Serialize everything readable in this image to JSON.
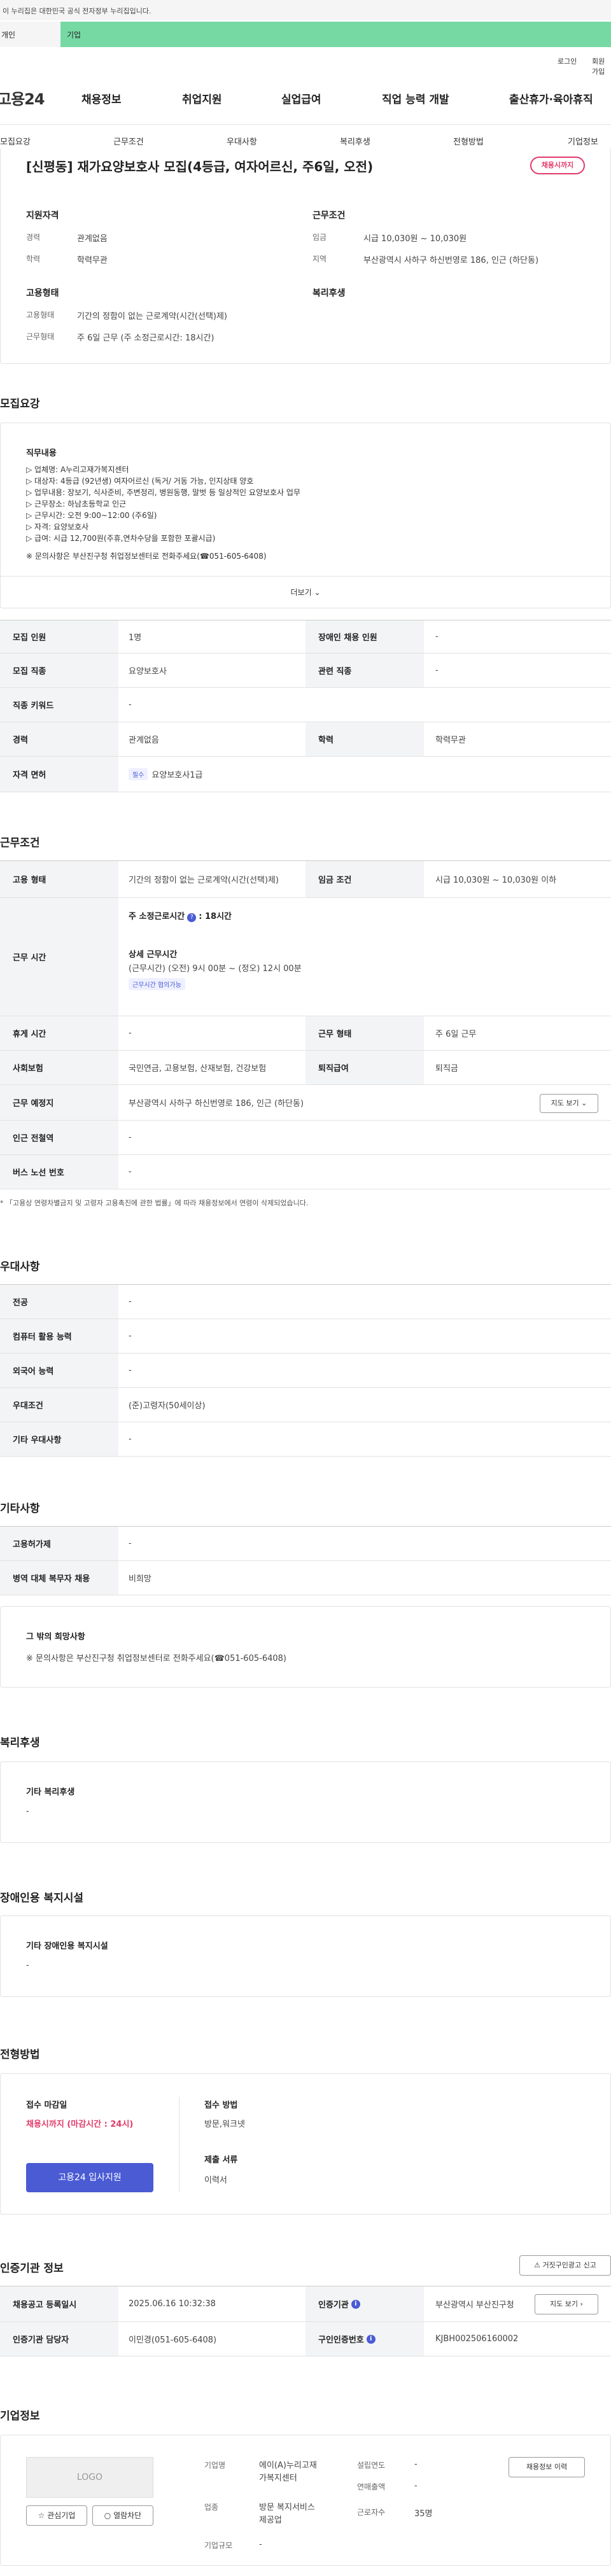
{
  "notice": "이 누리집은 대한민국 공식 전자정부 누리집입니다.",
  "top_tabs": [
    "개인",
    "기업"
  ],
  "util": [
    "로그인",
    "회원가입"
  ],
  "logo": "고용24",
  "gnb": [
    "채용정보",
    "취업지원",
    "실업급여",
    "직업 능력 개발",
    "출산휴가·육아휴직"
  ],
  "subnav": [
    "모집요강",
    "근무조건",
    "우대사항",
    "복리후생",
    "전형방법",
    "기업정보"
  ],
  "job": {
    "title": "[신평동] 재가요양보호사 모집(4등급, 여자어르신, 주6일, 오전)",
    "deadline_badge": "채용시까지",
    "qual_title": "지원자격",
    "cond_title": "근무조건",
    "career_l": "경력",
    "career_v": "관계없음",
    "edu_l": "학력",
    "edu_v": "학력무관",
    "wage_l": "임금",
    "wage_v": "시급 10,030원 ~ 10,030원",
    "region_l": "지역",
    "region_v": "부산광역시 사하구 하신번영로 186, 인근 (하단동)",
    "emp_title": "고용형태",
    "welfare_title": "복리후생",
    "emptype_l": "고용형태",
    "emptype_v": "기간의 정함이 없는 근로계약(시간(선택)제)",
    "worktype_l": "근무형태",
    "worktype_v": "주 6일 근무 (주 소정근로시간: 18시간)"
  },
  "recruit": {
    "heading": "모집요강",
    "duty_title": "직무내용",
    "lines": [
      "▷ 업체명: A누리고재가복지센터",
      "▷ 대상자:  4등급 (92년생) 여자어르신 (독거/ 거동 가능, 인지상태 양호",
      "▷ 업무내용: 장보기, 식사준비, 주변정리, 병원동행, 말벗 등 일상적인 요양보호사 업무",
      "▷ 근무장소: 하남초등학교 인근",
      "▷ 근무시간: 오전 9:00~12:00 (주6일)",
      "▷ 자격: 요양보호사",
      "▷ 급여: 시급 12,700원(주휴,연차수당을 포함한 포괄시급)"
    ],
    "contact": "※ 문의사항은 부산진구청 취업정보센터로 전화주세요(☎051-605-6408)",
    "more": "더보기"
  },
  "rtable": {
    "hc_l": "모집 인원",
    "hc_v": "1명",
    "dis_l": "장애인 채용 인원",
    "dis_v": "-",
    "job_l": "모집 직종",
    "job_v": "요양보호사",
    "rel_l": "관련 직종",
    "rel_v": "-",
    "kw_l": "직종 키워드",
    "kw_v": "-",
    "car_l": "경력",
    "car_v": "관계없음",
    "edu_l": "학력",
    "edu_v": "학력무관",
    "lic_l": "자격 면허",
    "lic_badge": "필수",
    "lic_v": "요양보호사1급"
  },
  "cond": {
    "heading": "근무조건",
    "emp_l": "고용 형태",
    "emp_v": "기간의 정함이 없는 근로계약(시간(선택)제)",
    "wage_l": "임금 조건",
    "wage_v": "시급 10,030원 ~ 10,030원 이하",
    "hours_l": "근무 시간",
    "weekly": "주 소정근로시간",
    "weekly_q": "?",
    "weekly_v": ": 18시간",
    "detail_title": "상세 근무시간",
    "detail_v": "(근무시간) (오전) 9시 00분 ~ (정오) 12시 00분",
    "consult": "근무시간 협의가능",
    "rest_l": "휴게 시간",
    "rest_v": "-",
    "form_l": "근무 형태",
    "form_v": "주 6일 근무",
    "ins_l": "사회보험",
    "ins_v": "국민연금, 고용보험, 산재보험, 건강보험",
    "sev_l": "퇴직급여",
    "sev_v": "퇴직금",
    "loc_l": "근무 예정지",
    "loc_v": "부산광역시 사하구 하신번영로 186, 인근 (하단동)",
    "map": "지도 보기",
    "sub_l": "인근 전철역",
    "sub_v": "-",
    "bus_l": "버스 노선 번호",
    "bus_v": "-",
    "note": "* 「고용상 연령차별금지 및 고령자 고용촉진에 관한 법률」에 따라 채용정보에서 연령이 삭제되었습니다."
  },
  "pref": {
    "heading": "우대사항",
    "rows": [
      [
        "전공",
        "-"
      ],
      [
        "컴퓨터 활용 능력",
        "-"
      ],
      [
        "외국어 능력",
        "-"
      ],
      [
        "우대조건",
        "(준)고령자(50세이상)"
      ],
      [
        "기타 우대사항",
        "-"
      ]
    ]
  },
  "etc": {
    "heading": "기타사항",
    "rows": [
      [
        "고용허가제",
        "-"
      ],
      [
        "병역 대체 복무자 채용",
        "비희망"
      ]
    ],
    "box_title": "그 밖의 희망사항",
    "box_v": "※ 문의사항은 부산진구청 취업정보센터로 전화주세요(☎051-605-6408)"
  },
  "welfare": {
    "heading": "복리후생",
    "title": "기타 복리후생",
    "v": "-"
  },
  "disab": {
    "heading": "장애인용 복지시설",
    "title": "기타 장애인용 복지시설",
    "v": "-"
  },
  "process": {
    "heading": "전형방법",
    "deadline_l": "접수 마감일",
    "deadline_v": "채용시까지 (마감시간 : 24시)",
    "apply": "고용24 입사지원",
    "method_l": "접수 방법",
    "method_v": "방문,워크넷",
    "docs_l": "제출 서류",
    "docs_v": "이력서"
  },
  "cert": {
    "heading": "인증기관 정보",
    "report": "거짓구인광고 신고",
    "reg_l": "채용공고 등록일시",
    "reg_v": "2025.06.16 10:32:38",
    "org_l": "인증기관",
    "org_v": "부산광역시 부산진구청",
    "map": "지도 보기",
    "mgr_l": "인증기관 담당자",
    "mgr_v": "이민경(051-605-6408)",
    "no_l": "구인인증번호",
    "no_v": "KJBH002506160002"
  },
  "company": {
    "heading": "기업정보",
    "logo": "LOGO",
    "fav": "관심기업",
    "block": "열람차단",
    "name_l": "기업명",
    "name_v1": "에이(A)누리고재",
    "name_v2": "가복지센터",
    "ind_l": "업종",
    "ind_v1": "방문 복지서비스",
    "ind_v2": "제공업",
    "size_l": "기업규모",
    "size_v": "-",
    "est_l": "설립연도",
    "est_v": "-",
    "sales_l": "연매출액",
    "sales_v": "-",
    "emp_l": "근로자수",
    "emp_v": "35명",
    "history": "채용정보 이력"
  }
}
